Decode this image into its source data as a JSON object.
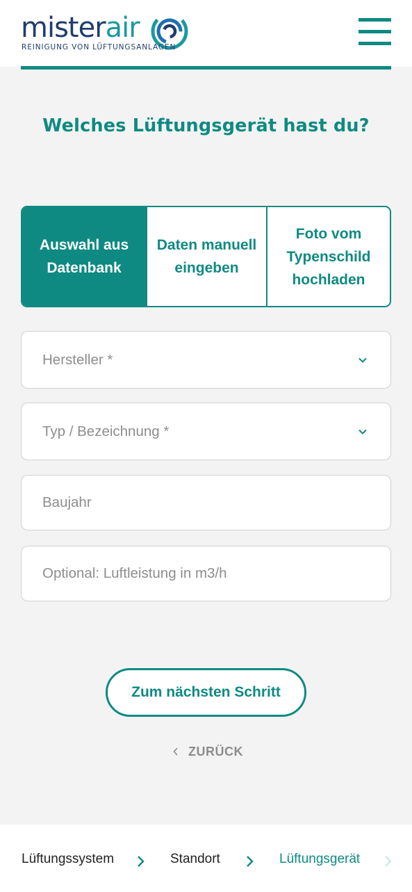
{
  "header": {
    "logo_word_main": "mister",
    "logo_word_accent": "air",
    "logo_tagline": "REINIGUNG VON LÜFTUNGSANLAGEN",
    "menu_icon": "hamburger-menu-icon",
    "brand_color": "#0e8a82",
    "logo_navy": "#1f3d6d"
  },
  "main": {
    "question": "Welches Lüftungsgerät hast du?",
    "tabs": [
      {
        "label": "Auswahl aus Datenbank",
        "active": true
      },
      {
        "label": "Daten manuell eingeben",
        "active": false
      },
      {
        "label": "Foto vom Typenschild hochladen",
        "active": false
      }
    ],
    "fields": {
      "manufacturer_placeholder": "Hersteller *",
      "type_placeholder": "Typ / Bezeichnung *",
      "year_placeholder": "Baujahr",
      "airflow_placeholder": "Optional: Luftleistung in m3/h"
    },
    "next_button": "Zum nächsten Schritt",
    "back_link": "ZURÜCK"
  },
  "footer": {
    "breadcrumbs": [
      {
        "label": "Lüftungssystem"
      },
      {
        "label": "Standort"
      },
      {
        "label": "Lüftungsgerät",
        "active": true
      }
    ]
  }
}
